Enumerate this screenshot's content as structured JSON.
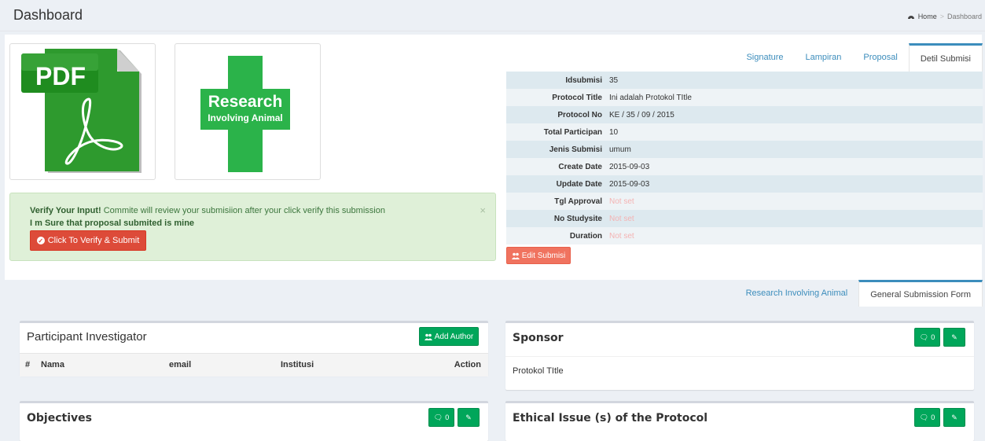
{
  "header": {
    "title": "Dashboard",
    "breadcrumb": {
      "home": "Home",
      "sep": ">",
      "current": "Dashboard"
    }
  },
  "thumbnails": {
    "pdf": {
      "label": "PDF"
    },
    "ria": {
      "line1": "Research",
      "line2": "Involving Animal"
    }
  },
  "alert": {
    "strong": "Verify Your Input!",
    "message": " Commite will review your submisiion after your click verify this submission",
    "line2": "I m Sure that proposal submited is mine",
    "close": "×",
    "button": "Click To Verify & Submit"
  },
  "detail_tabs": [
    "Signature",
    "Lampiran",
    "Proposal",
    "Detil Submisi"
  ],
  "detail_rows": [
    {
      "label": "Idsubmisi",
      "value": "35",
      "notset": false
    },
    {
      "label": "Protocol Title",
      "value": "Ini adalah Protokol TItle",
      "notset": false
    },
    {
      "label": "Protocol No",
      "value": "KE / 35 / 09 / 2015",
      "notset": false
    },
    {
      "label": "Total Participan",
      "value": "10",
      "notset": false
    },
    {
      "label": "Jenis Submisi",
      "value": "umum",
      "notset": false
    },
    {
      "label": "Create Date",
      "value": "2015-09-03",
      "notset": false
    },
    {
      "label": "Update Date",
      "value": "2015-09-03",
      "notset": false
    },
    {
      "label": "Tgl Approval",
      "value": "Not set",
      "notset": true
    },
    {
      "label": "No Studysite",
      "value": "Not set",
      "notset": true
    },
    {
      "label": "Duration",
      "value": "Not set",
      "notset": true
    }
  ],
  "edit_button": "Edit Submisi",
  "form_tabs": [
    "Research Involving Animal",
    "General Submission Form"
  ],
  "participant": {
    "title": "Participant Investigator",
    "add_button": "Add Author",
    "columns": [
      "#",
      "Nama",
      "email",
      "Institusi",
      "Action"
    ]
  },
  "sponsor": {
    "title": "Sponsor",
    "comment_count": "0",
    "text": "Protokol TItle"
  },
  "objectives": {
    "title": "Objectives",
    "comment_count": "0"
  },
  "ethical": {
    "title": "Ethical Issue (s) of the Protocol",
    "comment_count": "0"
  },
  "colors": {
    "primary": "#3c8dbc",
    "success": "#00a65a",
    "danger": "#dd4b39",
    "pdf_green": "#2e9a2e",
    "ria_green": "#2bb34a"
  }
}
